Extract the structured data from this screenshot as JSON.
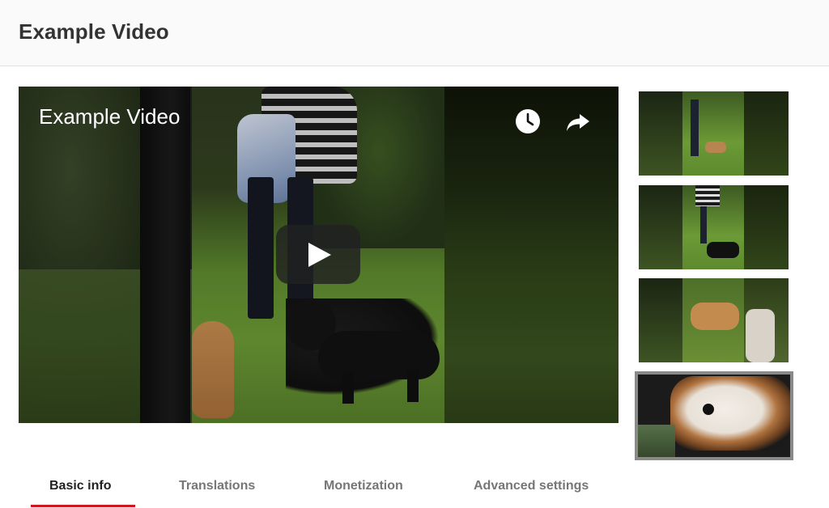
{
  "page": {
    "title": "Example Video"
  },
  "player": {
    "overlay_title": "Example Video",
    "controls": {
      "watch_later_icon": "clock-icon",
      "share_icon": "share-icon"
    },
    "play_icon": "play-icon"
  },
  "thumbnails": {
    "count": 4,
    "selected_index": 3
  },
  "tabs": [
    {
      "label": "Basic info",
      "active": true
    },
    {
      "label": "Translations",
      "active": false
    },
    {
      "label": "Monetization",
      "active": false
    },
    {
      "label": "Advanced settings",
      "active": false
    }
  ],
  "colors": {
    "tab_underline": "#cc181e",
    "thumb_selected_border": "#8a8a8a"
  }
}
